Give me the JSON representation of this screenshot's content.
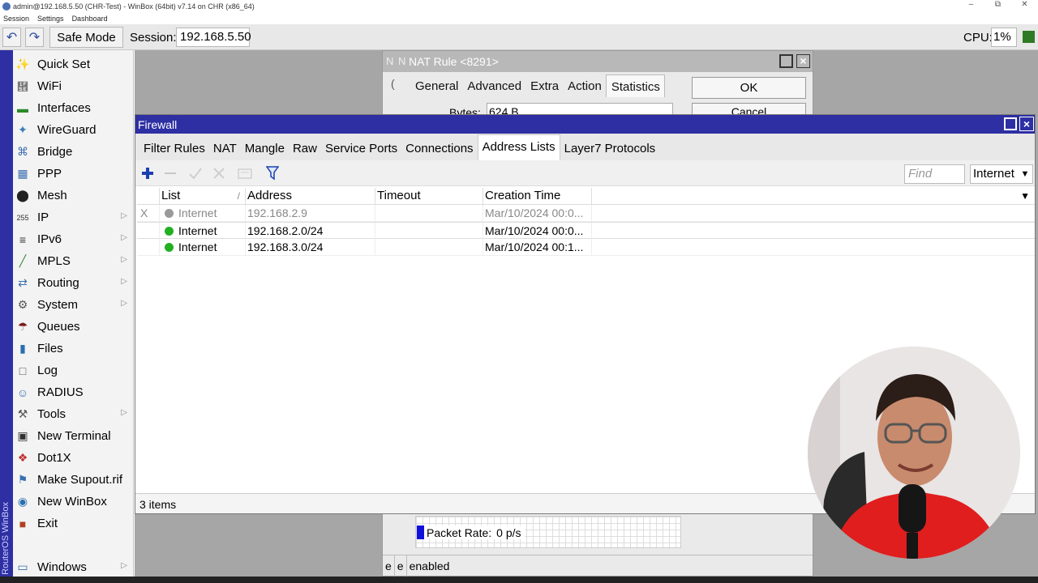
{
  "titlebar": {
    "text": "admin@192.168.5.50 (CHR-Test) - WinBox (64bit) v7.14 on CHR (x86_64)",
    "minimize": "–",
    "maximize": "⧉",
    "close": "✕"
  },
  "menubar": [
    "Session",
    "Settings",
    "Dashboard"
  ],
  "toolbar": {
    "undo_icon": "↶",
    "redo_icon": "↷",
    "safe_mode_label": "Safe Mode",
    "session_label": "Session:",
    "session_value": "192.168.5.50",
    "cpu_label": "CPU:",
    "cpu_value": "1%",
    "cpu_color": "#2f7a25"
  },
  "sidebar": {
    "brand": "RouterOS WinBox",
    "items": [
      {
        "label": "Quick Set",
        "icon": "wand-icon",
        "glyph": "✨",
        "submenu": false
      },
      {
        "label": "WiFi",
        "icon": "wifi-icon",
        "glyph": "὞",
        "submenu": false
      },
      {
        "label": "Interfaces",
        "icon": "interfaces-icon",
        "glyph": "▬",
        "submenu": false
      },
      {
        "label": "WireGuard",
        "icon": "wireguard-icon",
        "glyph": "✦",
        "submenu": false
      },
      {
        "label": "Bridge",
        "icon": "bridge-icon",
        "glyph": "⌘",
        "submenu": false
      },
      {
        "label": "PPP",
        "icon": "ppp-icon",
        "glyph": "▦",
        "submenu": false
      },
      {
        "label": "Mesh",
        "icon": "mesh-icon",
        "glyph": "⬤",
        "submenu": false
      },
      {
        "label": "IP",
        "icon": "ip-icon",
        "glyph": "255",
        "submenu": true
      },
      {
        "label": "IPv6",
        "icon": "ipv6-icon",
        "glyph": "≡",
        "submenu": true
      },
      {
        "label": "MPLS",
        "icon": "mpls-icon",
        "glyph": "╱",
        "submenu": true
      },
      {
        "label": "Routing",
        "icon": "routing-icon",
        "glyph": "⇄",
        "submenu": true
      },
      {
        "label": "System",
        "icon": "system-icon",
        "glyph": "⚙",
        "submenu": true
      },
      {
        "label": "Queues",
        "icon": "queues-icon",
        "glyph": "☂",
        "submenu": false
      },
      {
        "label": "Files",
        "icon": "files-icon",
        "glyph": "▮",
        "submenu": false
      },
      {
        "label": "Log",
        "icon": "log-icon",
        "glyph": "□",
        "submenu": false
      },
      {
        "label": "RADIUS",
        "icon": "radius-icon",
        "glyph": "☺",
        "submenu": false
      },
      {
        "label": "Tools",
        "icon": "tools-icon",
        "glyph": "⚒",
        "submenu": true
      },
      {
        "label": "New Terminal",
        "icon": "terminal-icon",
        "glyph": "▣",
        "submenu": false
      },
      {
        "label": "Dot1X",
        "icon": "dot1x-icon",
        "glyph": "❖",
        "submenu": false
      },
      {
        "label": "Make Supout.rif",
        "icon": "supout-icon",
        "glyph": "⚑",
        "submenu": false
      },
      {
        "label": "New WinBox",
        "icon": "winbox-icon",
        "glyph": "◉",
        "submenu": false
      },
      {
        "label": "Exit",
        "icon": "exit-icon",
        "glyph": "■",
        "submenu": false
      },
      {
        "label": "Windows",
        "icon": "windows-icon",
        "glyph": "▭",
        "submenu": true
      }
    ],
    "submenu_arrow": "▷"
  },
  "nat_window": {
    "title": "NAT Rule <8291>",
    "ghost_tabs": [
      "N",
      "N"
    ],
    "ghost_side": "(",
    "tabs": [
      "General",
      "Advanced",
      "Extra",
      "Action",
      "Statistics"
    ],
    "active_tab": "Statistics",
    "ok_label": "OK",
    "cancel_label": "Cancel",
    "bytes_label": "Bytes:",
    "bytes_value": "624 B",
    "packet_rate_label": "Packet Rate:",
    "packet_rate_value": "0 p/s",
    "packet_rate_color": "#1010dd",
    "status_cells": [
      "e",
      "e",
      "enabled"
    ]
  },
  "firewall": {
    "title": "Firewall",
    "tabs": [
      "Filter Rules",
      "NAT",
      "Mangle",
      "Raw",
      "Service Ports",
      "Connections",
      "Address Lists",
      "Layer7 Protocols"
    ],
    "active_tab": "Address Lists",
    "find_placeholder": "Find",
    "filter_value": "Internet",
    "columns": [
      "List",
      "Address",
      "Timeout",
      "Creation Time"
    ],
    "sort_indicator": "/",
    "rows": [
      {
        "flag": "X",
        "list": "Internet",
        "address": "192.168.2.9",
        "timeout": "",
        "created": "Mar/10/2024 00:0...",
        "dot_color": "#9a9a9a",
        "disabled": true
      },
      {
        "flag": "",
        "list": "Internet",
        "address": "192.168.2.0/24",
        "timeout": "",
        "created": "Mar/10/2024 00:0...",
        "dot_color": "#22b022",
        "disabled": false
      },
      {
        "flag": "",
        "list": "Internet",
        "address": "192.168.3.0/24",
        "timeout": "",
        "created": "Mar/10/2024 00:1...",
        "dot_color": "#22b022",
        "disabled": false
      }
    ],
    "status_count": "3 items"
  },
  "colors": {
    "window_title_active": "#2d2fa3",
    "window_title_inactive": "#b8b8b8",
    "desktop": "#a6a6a6"
  }
}
